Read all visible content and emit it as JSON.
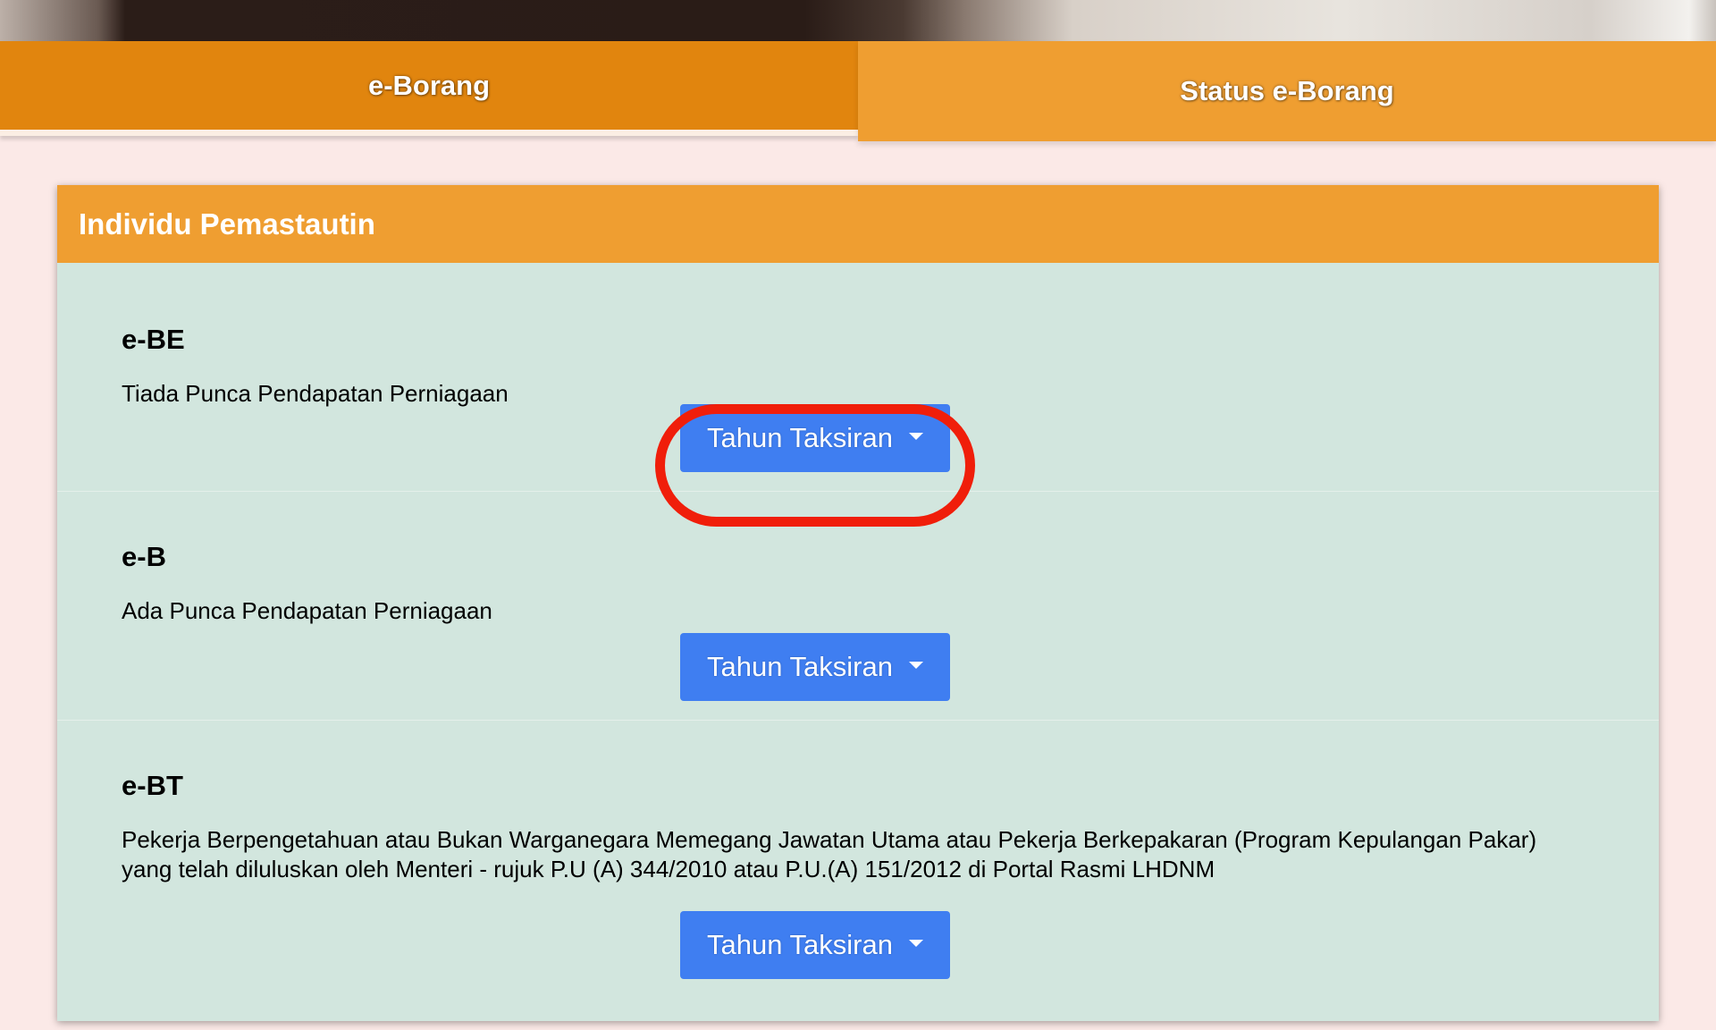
{
  "tabs": [
    {
      "label": "e-Borang",
      "active": true
    },
    {
      "label": "Status e-Borang",
      "active": false
    }
  ],
  "card": {
    "title": "Individu Pemastautin",
    "sections": [
      {
        "title": "e-BE",
        "description": "Tiada Punca Pendapatan Perniagaan",
        "button_label": "Tahun Taksiran"
      },
      {
        "title": "e-B",
        "description": "Ada Punca Pendapatan Perniagaan",
        "button_label": "Tahun Taksiran"
      },
      {
        "title": "e-BT",
        "description": "Pekerja Berpengetahuan atau Bukan Warganegara Memegang Jawatan Utama atau Pekerja Berkepakaran (Program Kepulangan Pakar) yang telah diluluskan oleh Menteri - rujuk P.U (A) 344/2010 atau P.U.(A) 151/2012 di Portal Rasmi LHDNM",
        "button_label": "Tahun Taksiran"
      }
    ]
  },
  "colors": {
    "tab_active": "#e1850e",
    "tab_inactive": "#ef9e31",
    "card_header": "#ef9e31",
    "card_body": "#d2e6de",
    "button": "#3f7ef1",
    "highlight": "#f01e0a",
    "page_bg": "#fbe9e7"
  }
}
